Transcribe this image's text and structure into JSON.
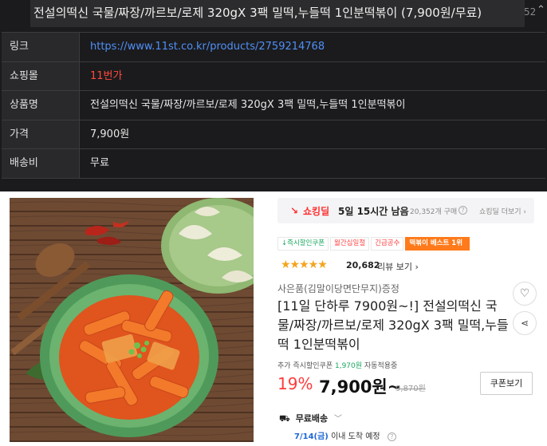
{
  "header": {
    "title": "전설의떡신 국물/짜장/까르보/로제 320gX 3팩 밀떡,누들떡 1인분떡볶이 (7,900원/무료)",
    "count": "52"
  },
  "info_table": [
    {
      "key": "링크",
      "value": "https://www.11st.co.kr/products/2759214768"
    },
    {
      "key": "쇼핑몰",
      "value": "11번가"
    },
    {
      "key": "상품명",
      "value": "전설의떡신 국물/짜장/까르보/로제 320gX 3팩 밀떡,누들떡 1인분떡볶이"
    },
    {
      "key": "가격",
      "value": "7,900원"
    },
    {
      "key": "배송비",
      "value": "무료"
    }
  ],
  "deal": {
    "name": "쇼킹딜",
    "time_left": "5일 15시간 남음",
    "purchases": "20,352개 구매",
    "help": "?",
    "more": "쇼킹딜 더보기 ›"
  },
  "badges": [
    "↓즉시할인쿠폰",
    "월간십일절",
    "긴급공수",
    "떡볶이 베스트 1위"
  ],
  "rating": {
    "stars": "★★★★★",
    "reviews": "20,682",
    "review_link": "리뷰 보기 ›",
    "value": 4.5
  },
  "product": {
    "gift": "사은품(김말이당면단무지)증정",
    "name": "[11일 단하루 7900원~!] 전설의떡신 국물/짜장/까르보/로제 320gX 3팩 밀떡,누들떡 1인분떡볶이",
    "coupon_prefix": "추가 즉시할인쿠폰",
    "coupon_amount": "1,970원",
    "coupon_suffix": "자동적용중",
    "discount": "19%",
    "price": "7,900원~",
    "original_price": "9,870원",
    "coupon_button": "쿠폰보기"
  },
  "shipping": {
    "label": "무료배송",
    "arrive_date": "7/14(금)",
    "arrive_text": "이내 도착 예정"
  },
  "icons": {
    "heart": "heart-icon",
    "share": "share-icon",
    "truck": "truck-icon",
    "deal": "lightning-icon"
  },
  "colors": {
    "link": "#4f8ff7",
    "mall": "#ff4a3d",
    "accent": "#ff3b3b",
    "badge_best": "#ff7a1a",
    "arrive": "#1f67d6"
  }
}
